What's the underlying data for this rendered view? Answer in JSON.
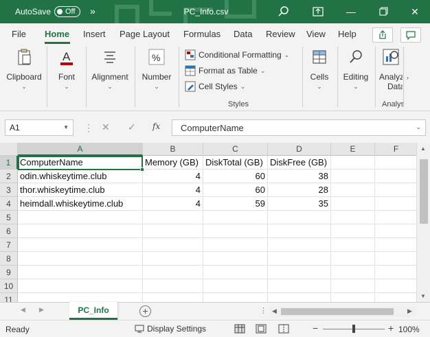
{
  "titlebar": {
    "autosave_label": "AutoSave",
    "autosave_state": "Off",
    "title": "PC_Info.csv",
    "more_glyph": "»"
  },
  "menu": {
    "tabs": [
      "File",
      "Home",
      "Insert",
      "Page Layout",
      "Formulas",
      "Data",
      "Review",
      "View",
      "Help"
    ],
    "active": "Home"
  },
  "ribbon": {
    "clipboard": "Clipboard",
    "font": "Font",
    "alignment": "Alignment",
    "number": "Number",
    "conditional_formatting": "Conditional Formatting",
    "format_as_table": "Format as Table",
    "cell_styles": "Cell Styles",
    "styles_group": "Styles",
    "cells": "Cells",
    "editing": "Editing",
    "analyze_line1": "Analyz",
    "analyze_line2": "Data",
    "analysis_group": "Analys"
  },
  "formula_bar": {
    "name_box": "A1",
    "fx": "fx",
    "content": "ComputerName"
  },
  "sheet": {
    "columns": [
      "A",
      "B",
      "C",
      "D",
      "E",
      "F"
    ],
    "row_numbers": [
      "1",
      "2",
      "3",
      "4",
      "5",
      "6",
      "7",
      "8",
      "9",
      "10",
      "11"
    ],
    "rows": [
      [
        "ComputerName",
        "Memory (GB)",
        "DiskTotal (GB)",
        "DiskFree (GB)",
        "",
        ""
      ],
      [
        "odin.whiskeytime.club",
        "4",
        "60",
        "38",
        "",
        ""
      ],
      [
        "thor.whiskeytime.club",
        "4",
        "60",
        "28",
        "",
        ""
      ],
      [
        "heimdall.whiskeytime.club",
        "4",
        "59",
        "35",
        "",
        ""
      ]
    ],
    "selected_cell": "A1"
  },
  "sheet_tabs": {
    "active_tab": "PC_Info"
  },
  "status": {
    "ready": "Ready",
    "display_settings": "Display Settings",
    "zoom": "100%"
  },
  "colors": {
    "accent": "#217346"
  }
}
